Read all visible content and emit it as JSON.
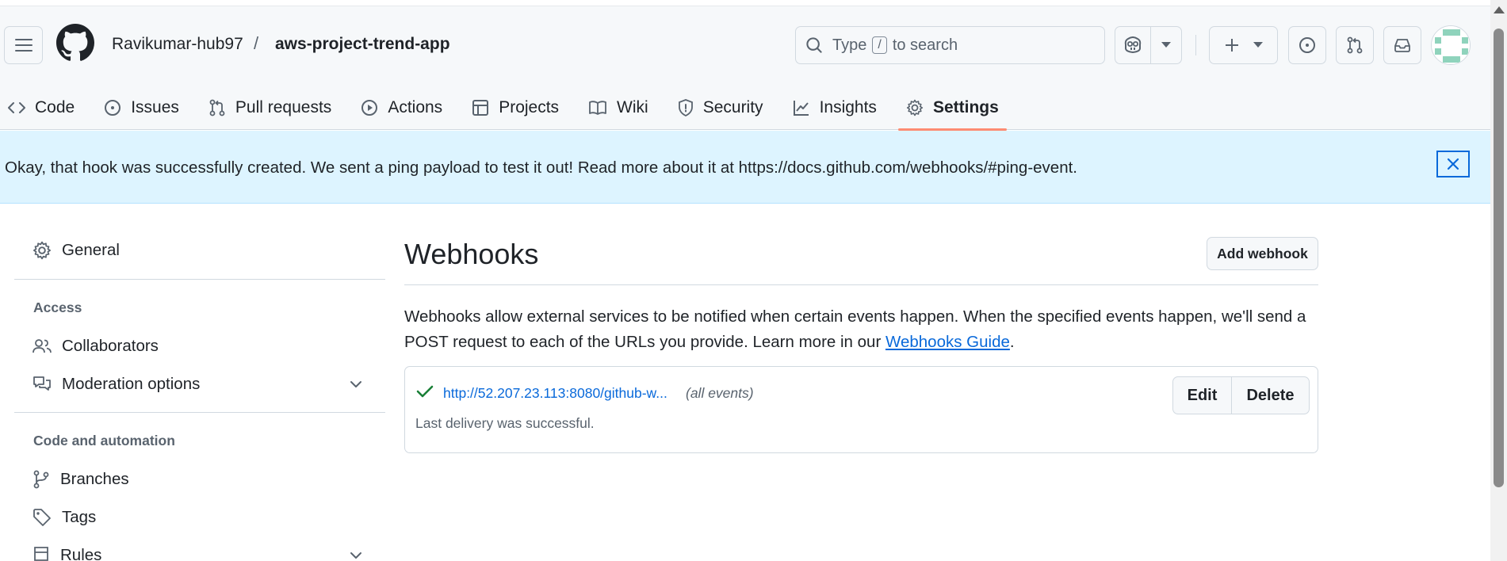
{
  "header": {
    "owner": "Ravikumar-hub97",
    "separator": "/",
    "repo": "aws-project-trend-app",
    "search": {
      "prefix": "Type",
      "key": "/",
      "suffix": "to search"
    }
  },
  "nav": {
    "tabs": [
      {
        "label": "Code",
        "icon": "code-icon",
        "active": false
      },
      {
        "label": "Issues",
        "icon": "issue-opened-icon",
        "active": false
      },
      {
        "label": "Pull requests",
        "icon": "git-pull-request-icon",
        "active": false
      },
      {
        "label": "Actions",
        "icon": "play-icon",
        "active": false
      },
      {
        "label": "Projects",
        "icon": "table-icon",
        "active": false
      },
      {
        "label": "Wiki",
        "icon": "book-icon",
        "active": false
      },
      {
        "label": "Security",
        "icon": "shield-icon",
        "active": false
      },
      {
        "label": "Insights",
        "icon": "graph-icon",
        "active": false
      },
      {
        "label": "Settings",
        "icon": "gear-icon",
        "active": true
      }
    ]
  },
  "flash": {
    "message": "Okay, that hook was successfully created. We sent a ping payload to test it out! Read more about it at https://docs.github.com/webhooks/#ping-event."
  },
  "sidebar": {
    "general": "General",
    "access_heading": "Access",
    "collaborators": "Collaborators",
    "moderation": "Moderation options",
    "code_heading": "Code and automation",
    "branches": "Branches",
    "tags": "Tags",
    "rules": "Rules"
  },
  "main": {
    "title": "Webhooks",
    "add_button": "Add webhook",
    "intro_text": "Webhooks allow external services to be notified when certain events happen. When the specified events happen, we'll send a POST request to each of the URLs you provide. Learn more in our ",
    "intro_link": "Webhooks Guide",
    "intro_end": ".",
    "hooks": [
      {
        "url": "http://52.207.23.113:8080/github-w...",
        "events": "(all events)",
        "status": "Last delivery was successful.",
        "edit_label": "Edit",
        "delete_label": "Delete"
      }
    ]
  },
  "colors": {
    "accent": "#0969da",
    "success": "#1a7f37",
    "flash_bg": "#ddf4ff",
    "tab_underline": "#fd8c73"
  }
}
